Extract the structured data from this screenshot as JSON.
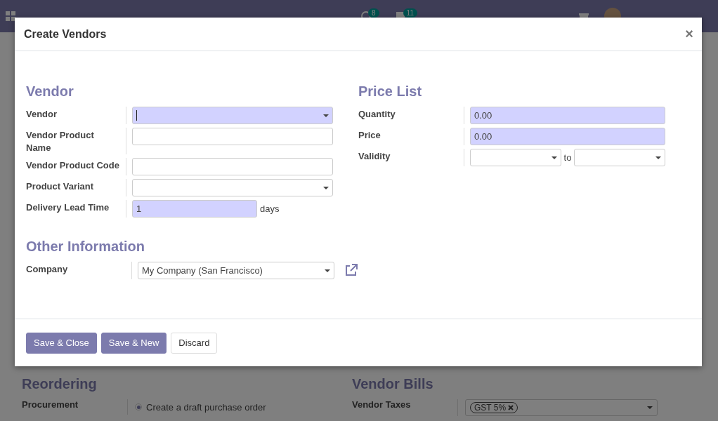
{
  "navbar": {
    "activity_count": "8",
    "message_count": "11"
  },
  "dialog": {
    "title": "Create Vendors",
    "close": "×",
    "columns": [
      {
        "title": "Vendor",
        "fields": [
          {
            "label": "Vendor",
            "kind": "select",
            "required": true,
            "focused": true
          },
          {
            "label": "Vendor Product Name",
            "kind": "text",
            "required": false
          },
          {
            "label": "Vendor Product Code",
            "kind": "text",
            "required": false
          },
          {
            "label": "Product Variant",
            "kind": "select",
            "required": false
          },
          {
            "label": "Delivery Lead Time",
            "kind": "number_unit",
            "required": true,
            "value": "1",
            "unit": "days"
          }
        ]
      },
      {
        "title": "Price List",
        "fields": [
          {
            "label": "Quantity",
            "kind": "text",
            "required": true,
            "value": "0.00"
          },
          {
            "label": "Price",
            "kind": "text",
            "required": true,
            "value": "0.00"
          },
          {
            "label": "Validity",
            "kind": "date_range",
            "required": false,
            "separator": "to"
          }
        ]
      }
    ],
    "other": {
      "title": "Other Information",
      "fields": [
        {
          "label": "Company",
          "kind": "select",
          "required": false,
          "value": "My Company (San Francisco)",
          "external_link": true
        }
      ]
    },
    "buttons": [
      {
        "label": "Save & Close",
        "kind": "primary"
      },
      {
        "label": "Save & New",
        "kind": "primary"
      },
      {
        "label": "Discard",
        "kind": "secondary"
      }
    ]
  },
  "background_form": {
    "reordering": {
      "title": "Reordering",
      "label": "Procurement",
      "option": {
        "label": "Create a draft purchase order",
        "selected": true
      }
    },
    "vendor_bills": {
      "title": "Vendor Bills",
      "label": "Vendor Taxes",
      "tags": [
        "GST 5%"
      ]
    }
  }
}
